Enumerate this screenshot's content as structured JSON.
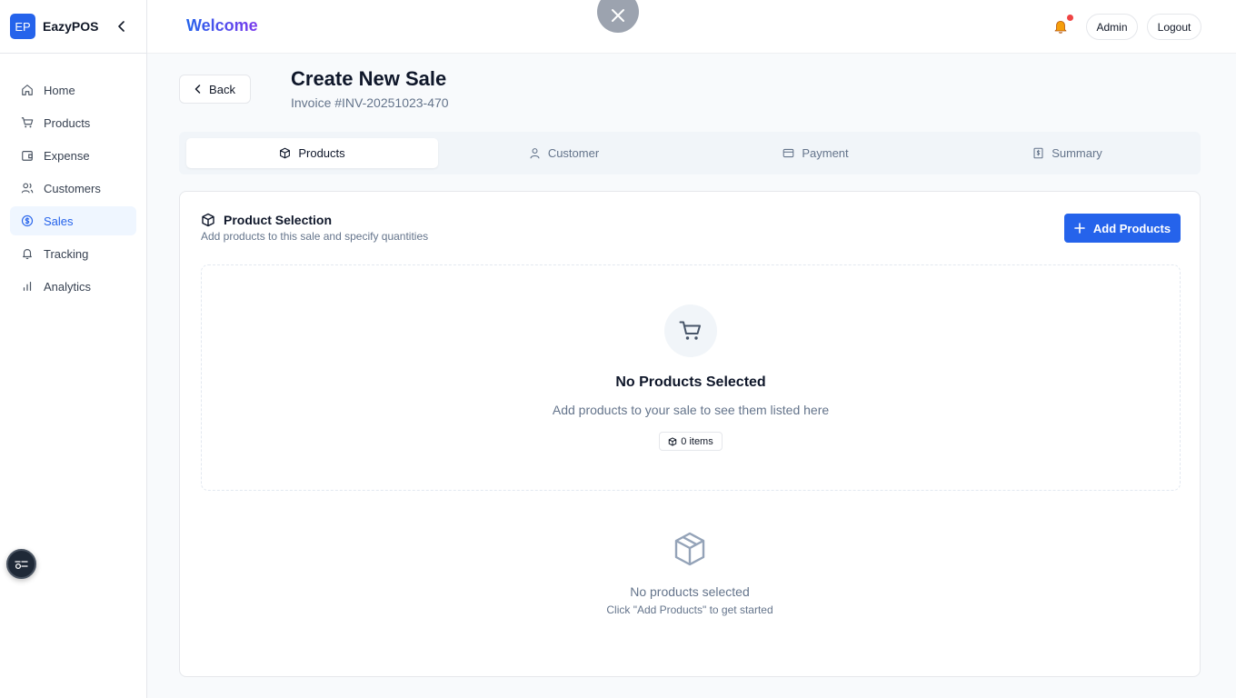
{
  "brand": {
    "logo": "EP",
    "name": "EazyPOS"
  },
  "sidebar": {
    "items": [
      {
        "label": "Home",
        "icon": "home-icon"
      },
      {
        "label": "Products",
        "icon": "cart-icon"
      },
      {
        "label": "Expense",
        "icon": "wallet-icon"
      },
      {
        "label": "Customers",
        "icon": "users-icon"
      },
      {
        "label": "Sales",
        "icon": "dollar-circle-icon",
        "active": true
      },
      {
        "label": "Tracking",
        "icon": "bell-icon"
      },
      {
        "label": "Analytics",
        "icon": "bar-chart-icon"
      }
    ]
  },
  "header": {
    "welcome": "Welcome",
    "admin_label": "Admin",
    "logout_label": "Logout",
    "notification_dot": true
  },
  "page": {
    "back_label": "Back",
    "title": "Create New Sale",
    "invoice": "Invoice #INV-20251023-470"
  },
  "tabs": [
    {
      "label": "Products",
      "icon": "box-icon",
      "active": true
    },
    {
      "label": "Customer",
      "icon": "user-icon"
    },
    {
      "label": "Payment",
      "icon": "credit-card-icon"
    },
    {
      "label": "Summary",
      "icon": "receipt-icon"
    }
  ],
  "product_section": {
    "title": "Product Selection",
    "subtitle": "Add products to this sale and specify quantities",
    "add_button": "Add Products",
    "empty_title": "No Products Selected",
    "empty_desc": "Add products to your sale to see them listed here",
    "items_badge": "0 items",
    "empty2_title": "No products selected",
    "empty2_desc": "Click \"Add Products\" to get started"
  },
  "colors": {
    "primary": "#2563eb",
    "welcome_gradient_end": "#7c3aed",
    "notification": "#ef4444",
    "bell": "#f59e0b"
  }
}
